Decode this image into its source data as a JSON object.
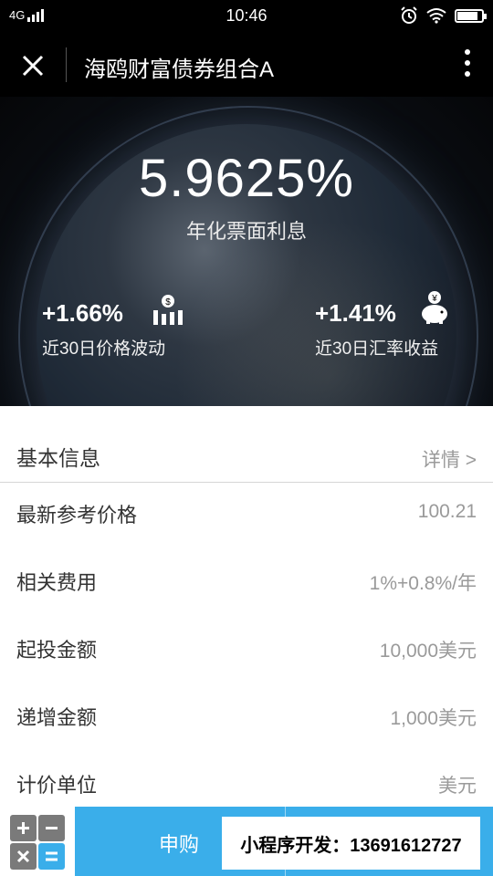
{
  "status_bar": {
    "network": "4G",
    "time": "10:46"
  },
  "nav": {
    "title": "海鸥财富债券组合A"
  },
  "hero": {
    "rate": "5.9625%",
    "rate_label": "年化票面利息",
    "stats": [
      {
        "value": "+1.66%",
        "label": "近30日价格波动",
        "icon": "bar-chart-dollar-icon"
      },
      {
        "value": "+1.41%",
        "label": "近30日汇率收益",
        "icon": "piggy-bank-yen-icon"
      }
    ]
  },
  "info": {
    "section_title": "基本信息",
    "details_link": "详情 >",
    "rows": [
      {
        "label": "最新参考价格",
        "value": "100.21"
      },
      {
        "label": "相关费用",
        "value": "1%+0.8%/年"
      },
      {
        "label": "起投金额",
        "value": "10,000美元"
      },
      {
        "label": "递增金额",
        "value": "1,000美元"
      },
      {
        "label": "计价单位",
        "value": "美元"
      }
    ]
  },
  "bottom": {
    "buy_label": "申购",
    "watermark": "小程序开发：13691612727"
  },
  "colors": {
    "accent": "#3aaeea",
    "hero_bg": "#0c1016",
    "value_gray": "#9a9a9a"
  }
}
